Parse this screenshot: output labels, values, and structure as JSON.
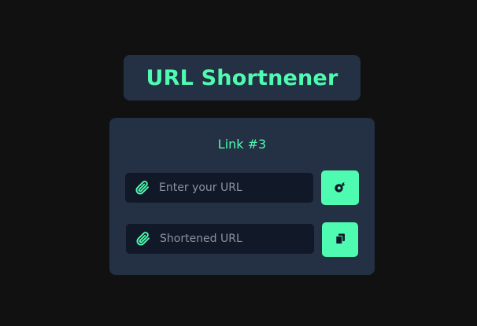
{
  "app": {
    "title": "URL Shortnener"
  },
  "card": {
    "link_label": "Link #3",
    "url_input": {
      "value": "",
      "placeholder": "Enter your URL",
      "icon": "paperclip-icon"
    },
    "shorten_button": {
      "icon": "shorten-icon"
    },
    "short_output": {
      "value": "",
      "placeholder": "Shortened URL",
      "icon": "paperclip-icon"
    },
    "copy_button": {
      "icon": "copy-icon"
    }
  },
  "colors": {
    "background": "#111111",
    "panel": "#243044",
    "field": "#111827",
    "accent": "#4ffbb0",
    "placeholder": "#8b93a1"
  }
}
